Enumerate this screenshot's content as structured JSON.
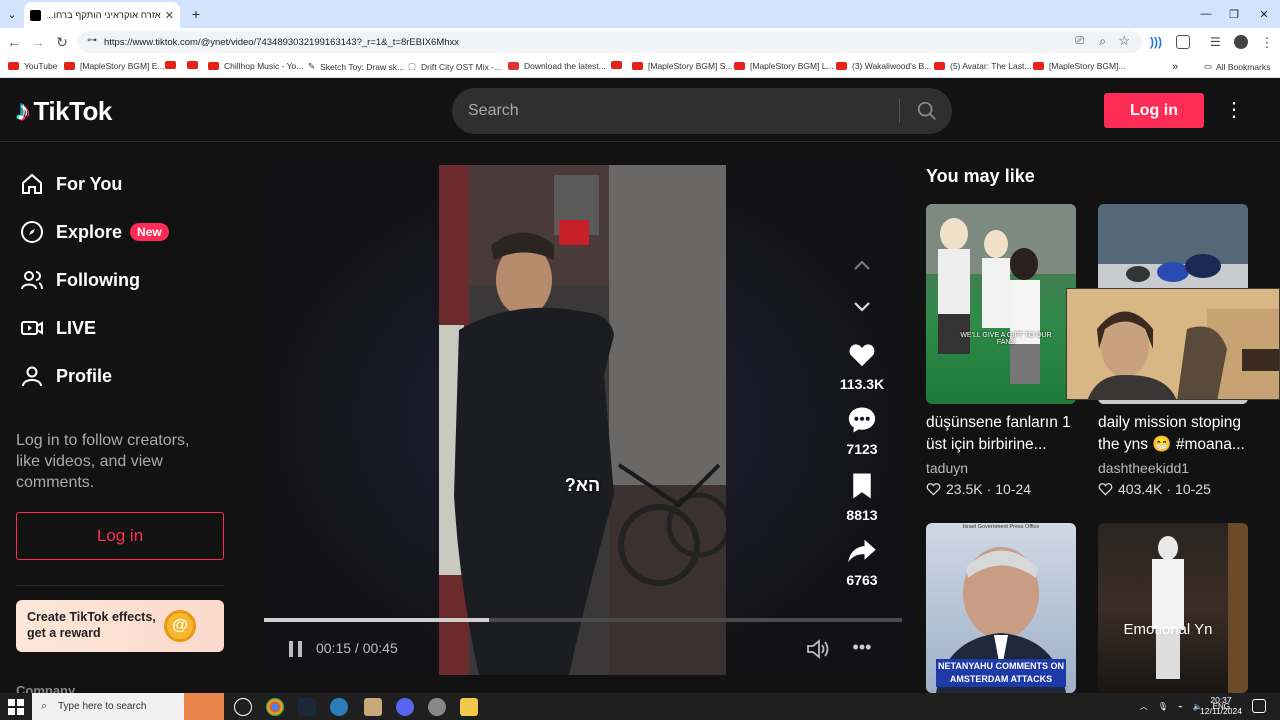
{
  "browser": {
    "tab_title": "אזרח אוקראיני הותקף ברחו...",
    "tab_close": "✕",
    "new_tab": "+",
    "url": "https://www.tiktok.com/@ynet/video/7434893032199163143?_r=1&_t=8rEBIX6Mhxx",
    "bookmarks": [
      {
        "label": "YouTube"
      },
      {
        "label": "[MapleStory BGM] E..."
      },
      {
        "label": ""
      },
      {
        "label": "Chillhop Music - Yo..."
      },
      {
        "label": "Sketch Toy: Draw sk..."
      },
      {
        "label": "Drift City OST Mix -..."
      },
      {
        "label": "Download the latest..."
      },
      {
        "label": "[MapleStory BGM] S..."
      },
      {
        "label": "[MapleStory BGM] L..."
      },
      {
        "label": "(3) Wakaliwood's B..."
      },
      {
        "label": "(5) Avatar: The Last..."
      },
      {
        "label": "[MapleStory BGM]..."
      }
    ],
    "all_bookmarks": "All Bookmarks",
    "overflow": "»"
  },
  "header": {
    "logo_text": "TikTok",
    "search_placeholder": "Search",
    "login_label": "Log in",
    "more_icon": "⋮"
  },
  "sidebar": {
    "items": [
      {
        "label": "For You",
        "icon": "home-icon"
      },
      {
        "label": "Explore",
        "icon": "compass-icon",
        "badge": "New"
      },
      {
        "label": "Following",
        "icon": "users-icon"
      },
      {
        "label": "LIVE",
        "icon": "live-icon"
      },
      {
        "label": "Profile",
        "icon": "profile-icon"
      }
    ],
    "message": "Log in to follow creators, like videos, and view comments.",
    "login_label": "Log in",
    "effects_banner": "Create TikTok effects, get a reward",
    "company": "Company"
  },
  "video": {
    "caption": "?הא",
    "progress": 0.353,
    "time": "00:15 / 00:45",
    "likes": "113.3K",
    "comments": "7123",
    "saves": "8813",
    "shares": "6763",
    "more_icon": "•••"
  },
  "recommendations": {
    "title": "You may like",
    "cards": [
      {
        "title": "düşünsene fanların 1 üst için birbirine...",
        "user": "taduyn",
        "likes": "23.5K",
        "date": "10-24",
        "overlay": "WE'LL GIVE A GIFT TO OUR FANS"
      },
      {
        "title": "daily mission stoping the yns 😁 #moana...",
        "user": "dashtheekidd1",
        "likes": "403.4K",
        "date": "10-25",
        "overlay": ""
      },
      {
        "title": "",
        "user": "",
        "likes": "",
        "date": "",
        "overlay": "NETANYAHU COMMENTS ON AMSTERDAM ATTACKS",
        "top_label": "Israel Government Press Office"
      },
      {
        "title": "",
        "user": "",
        "likes": "",
        "date": "",
        "overlay": "Emotional Yn"
      }
    ]
  },
  "taskbar": {
    "search_placeholder": "Type here to search",
    "lang": "ENG",
    "time": "20:37",
    "date": "12/11/2024"
  }
}
